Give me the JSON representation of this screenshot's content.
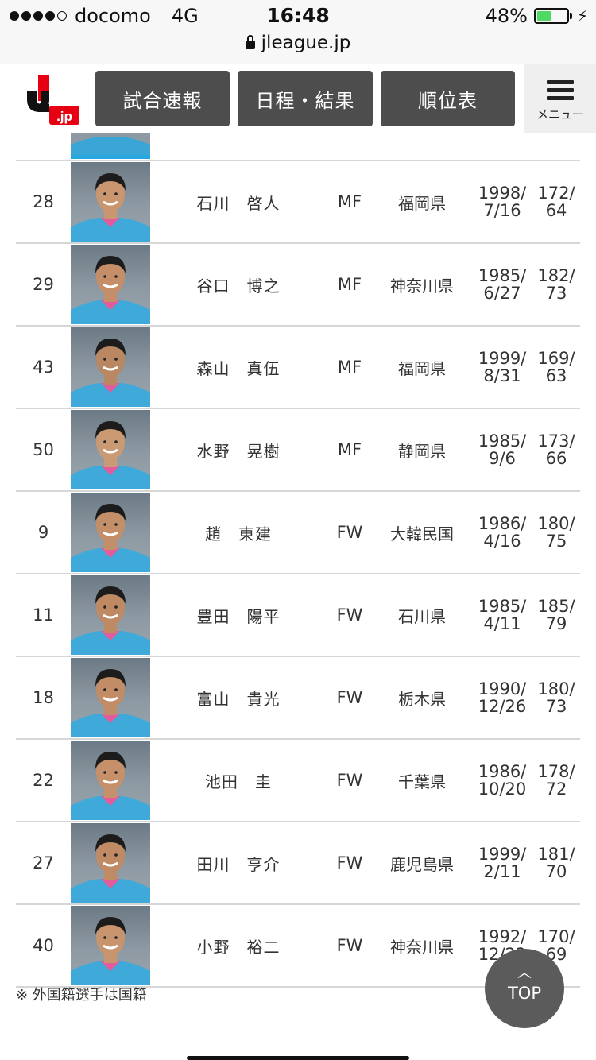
{
  "status_bar": {
    "carrier": "docomo",
    "network": "4G",
    "time": "16:48",
    "battery": "48%",
    "battery_level": 0.48,
    "url": "jleague.jp"
  },
  "header": {
    "logo_text": ".jp",
    "nav": [
      "試合速報",
      "日程・結果",
      "順位表"
    ],
    "menu_label": "メニュー"
  },
  "players": [
    {
      "no": "28",
      "name": "石川　啓人",
      "pos": "MF",
      "from": "福岡県",
      "birth1": "1998/",
      "birth2": "7/16",
      "size1": "172/",
      "size2": "64"
    },
    {
      "no": "29",
      "name": "谷口　博之",
      "pos": "MF",
      "from": "神奈川県",
      "birth1": "1985/",
      "birth2": "6/27",
      "size1": "182/",
      "size2": "73"
    },
    {
      "no": "43",
      "name": "森山　真伍",
      "pos": "MF",
      "from": "福岡県",
      "birth1": "1999/",
      "birth2": "8/31",
      "size1": "169/",
      "size2": "63"
    },
    {
      "no": "50",
      "name": "水野　晃樹",
      "pos": "MF",
      "from": "静岡県",
      "birth1": "1985/",
      "birth2": "9/6",
      "size1": "173/",
      "size2": "66"
    },
    {
      "no": "9",
      "name": "趙　東建",
      "pos": "FW",
      "from": "大韓民国",
      "birth1": "1986/",
      "birth2": "4/16",
      "size1": "180/",
      "size2": "75"
    },
    {
      "no": "11",
      "name": "豊田　陽平",
      "pos": "FW",
      "from": "石川県",
      "birth1": "1985/",
      "birth2": "4/11",
      "size1": "185/",
      "size2": "79"
    },
    {
      "no": "18",
      "name": "富山　貴光",
      "pos": "FW",
      "from": "栃木県",
      "birth1": "1990/",
      "birth2": "12/26",
      "size1": "180/",
      "size2": "73"
    },
    {
      "no": "22",
      "name": "池田　圭",
      "pos": "FW",
      "from": "千葉県",
      "birth1": "1986/",
      "birth2": "10/20",
      "size1": "178/",
      "size2": "72"
    },
    {
      "no": "27",
      "name": "田川　亨介",
      "pos": "FW",
      "from": "鹿児島県",
      "birth1": "1999/",
      "birth2": "2/11",
      "size1": "181/",
      "size2": "70"
    },
    {
      "no": "40",
      "name": "小野　裕二",
      "pos": "FW",
      "from": "神奈川県",
      "birth1": "1992/",
      "birth2": "12/22",
      "size1": "170/",
      "size2": "69"
    }
  ],
  "footnote": "※ 外国籍選手は国籍",
  "top_button": "TOP"
}
